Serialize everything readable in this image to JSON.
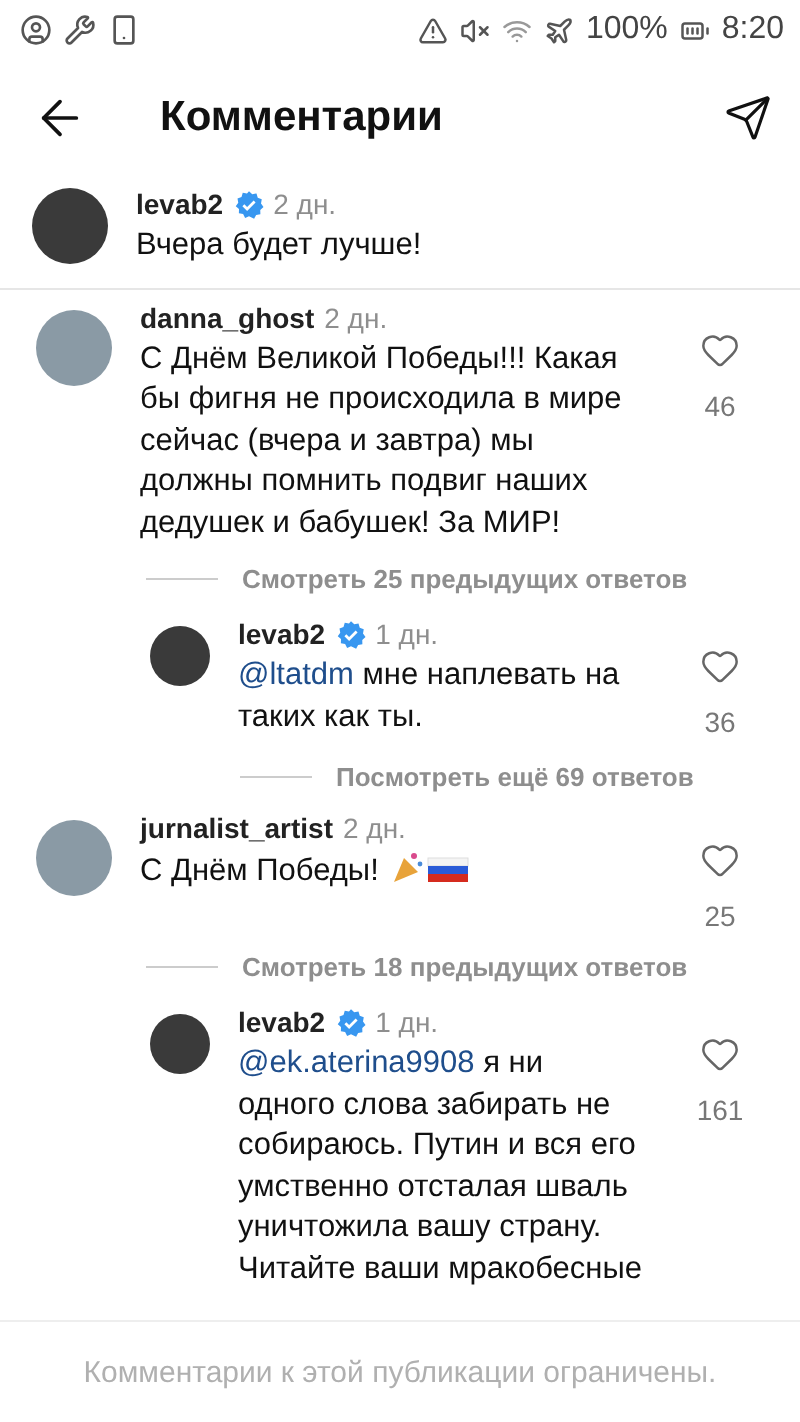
{
  "status_bar": {
    "battery": "100%",
    "time": "8:20"
  },
  "header": {
    "title": "Комментарии"
  },
  "caption": {
    "author": "levab2",
    "verified": true,
    "time": "2 дн.",
    "text": "Вчера будет лучше!"
  },
  "threads": [
    {
      "author": "danna_ghost",
      "verified": false,
      "time": "2 дн.",
      "text": "С Днём Великой Победы!!! Какая бы фигня не происходила в мире сейчас (вчера и завтра) мы должны помнить подвиг наших дедушек и бабушек! За МИР!",
      "emoji": false,
      "likes": "46",
      "previous_link": "Смотреть 25 предыдущих ответов",
      "replies": [
        {
          "author": "levab2",
          "verified": true,
          "time": "1 дн.",
          "mention": "@ltatdm",
          "text": "мне наплевать на таких как ты.",
          "likes": "36"
        }
      ],
      "more_link": "Посмотреть ещё 69 ответов"
    },
    {
      "author": "jurnalist_artist",
      "verified": false,
      "time": "2 дн.",
      "text": "С Днём Победы!",
      "emoji": true,
      "likes": "25",
      "previous_link": "Смотреть 18 предыдущих ответов",
      "replies": [
        {
          "author": "levab2",
          "verified": true,
          "time": "1 дн.",
          "mention": "@ek.aterina9908",
          "text": "я ни одного слова забирать не собираюсь. Путин и вся его умственно отсталая шваль уничтожила вашу страну. Читайте ваши мракобесные",
          "likes": "161"
        }
      ]
    }
  ],
  "footer": {
    "notice": "Комментарии к этой публикации ограничены."
  }
}
